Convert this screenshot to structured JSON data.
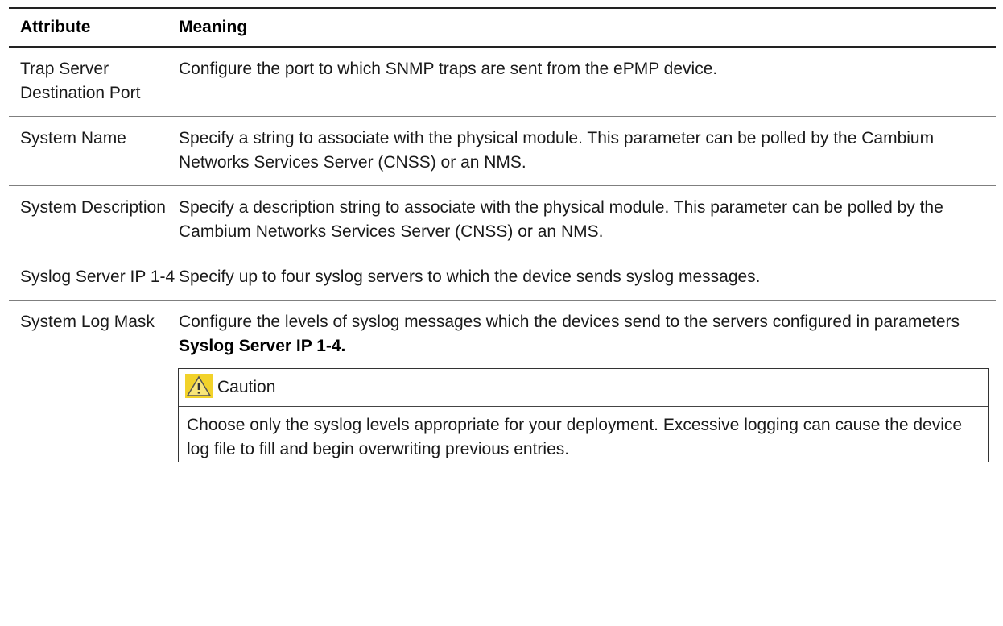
{
  "header": {
    "attribute": "Attribute",
    "meaning": "Meaning"
  },
  "rows": [
    {
      "attribute_line1": "Trap Server",
      "attribute_line2": "Destination Port",
      "meaning": "Configure the port to which SNMP traps are sent from the ePMP device."
    },
    {
      "attribute": "System Name",
      "meaning": "Specify a string to associate with the physical module. This parameter can be polled by the Cambium Networks Services Server (CNSS) or an NMS."
    },
    {
      "attribute": "System Description",
      "meaning": "Specify a description string to associate with the physical module. This parameter can be polled by the Cambium Networks Services Server (CNSS) or an NMS."
    },
    {
      "attribute": "Syslog Server IP 1-4",
      "meaning": "Specify up to four syslog servers to which the device sends syslog messages."
    },
    {
      "attribute": "System Log Mask",
      "meaning_prefix": "Configure the levels of syslog messages which the devices send to the servers configured in parameters ",
      "meaning_strong": "Syslog Server IP 1-4.",
      "caution": {
        "icon": "warning-triangle-icon",
        "title": "Caution",
        "text": "Choose only the syslog levels appropriate for your deployment. Excessive logging can cause the device log file to fill and begin overwriting previous entries."
      }
    }
  ],
  "colors": {
    "caution_icon": "#f2d22a",
    "rule": "#7f7f7f"
  }
}
